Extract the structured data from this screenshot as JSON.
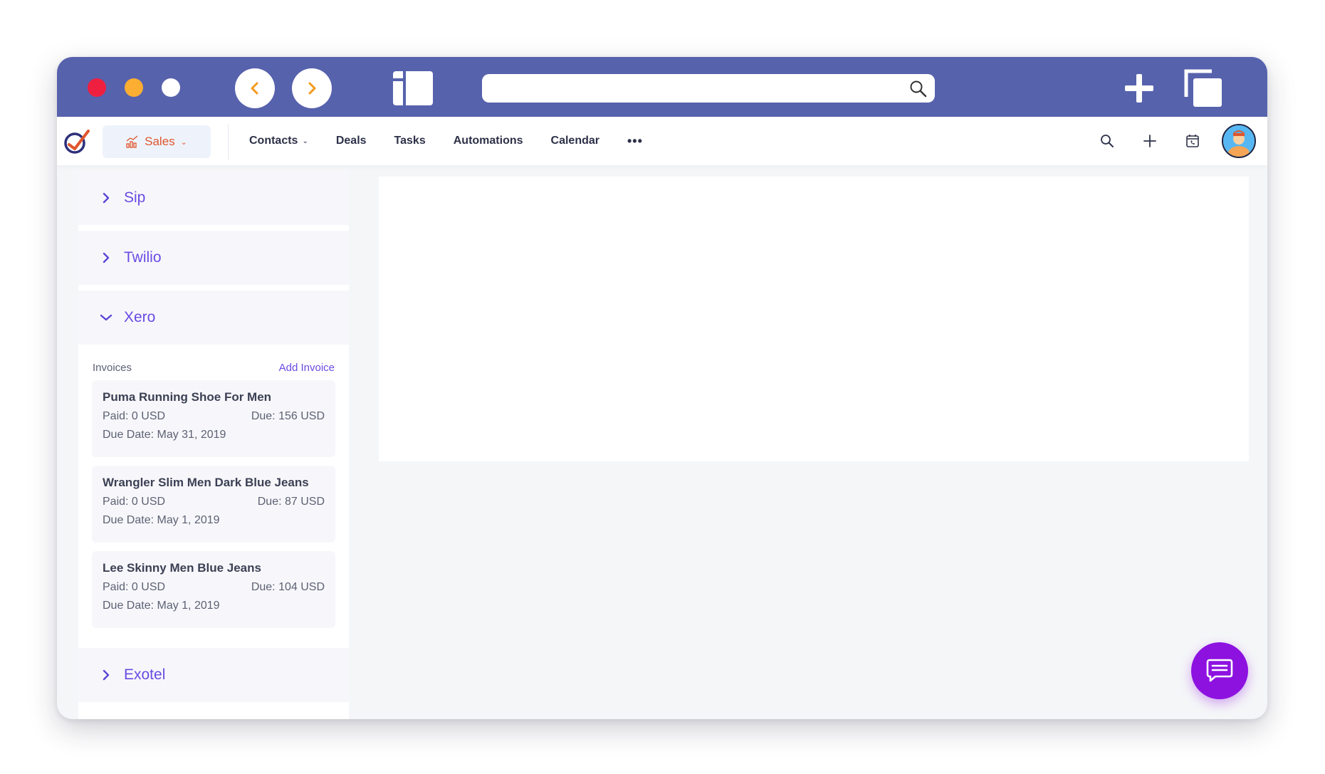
{
  "browser": {
    "address_value": "",
    "icons": [
      "back-arrow-icon",
      "forward-arrow-icon",
      "sidebar-icon",
      "search-icon",
      "plus-icon",
      "tabs-icon"
    ]
  },
  "app": {
    "module_label": "Sales",
    "menu": {
      "contacts": "Contacts",
      "deals": "Deals",
      "tasks": "Tasks",
      "automations": "Automations",
      "calendar": "Calendar",
      "more": "•••"
    }
  },
  "integrations": {
    "sip": "Sip",
    "twilio": "Twilio",
    "xero": "Xero",
    "exotel": "Exotel"
  },
  "xero": {
    "invoices_label": "Invoices",
    "add_invoice_label": "Add Invoice",
    "invoices": [
      {
        "name": "Puma Running Shoe For Men",
        "paid": "Paid: 0 USD",
        "due": "Due: 156 USD",
        "due_date": "Due Date: May 31, 2019"
      },
      {
        "name": "Wrangler Slim Men Dark Blue Jeans",
        "paid": "Paid: 0 USD",
        "due": "Due: 87 USD",
        "due_date": "Due Date: May 1, 2019"
      },
      {
        "name": "Lee Skinny Men Blue Jeans",
        "paid": "Paid: 0 USD",
        "due": "Due: 104 USD",
        "due_date": "Due Date: May 1, 2019"
      }
    ]
  },
  "colors": {
    "titlebar": "#5762ad",
    "accent_purple": "#6a4be3",
    "sales_orange": "#e0552d",
    "chat_button": "#8d12e0"
  }
}
